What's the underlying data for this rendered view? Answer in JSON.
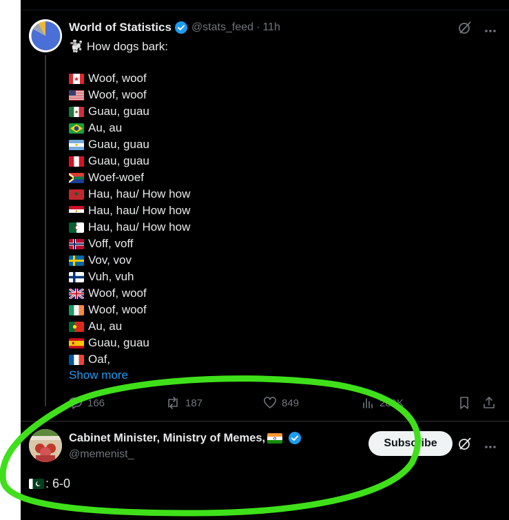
{
  "post": {
    "author_name": "World of Statistics",
    "handle": "@stats_feed",
    "separator": "·",
    "time": "11h",
    "intro": "How dogs bark:",
    "intro_emoji": "🐩",
    "lines": [
      {
        "flag": "canada",
        "text": "Woof, woof"
      },
      {
        "flag": "usa",
        "text": "Woof, woof"
      },
      {
        "flag": "mexico",
        "text": "Guau, guau"
      },
      {
        "flag": "brazil",
        "text": "Au, au"
      },
      {
        "flag": "argentina",
        "text": "Guau, guau"
      },
      {
        "flag": "peru",
        "text": "Guau, guau"
      },
      {
        "flag": "south-africa",
        "text": "Woef-woef"
      },
      {
        "flag": "morocco",
        "text": "Hau, hau/ How how"
      },
      {
        "flag": "egypt",
        "text": "Hau, hau/ How how"
      },
      {
        "flag": "algeria",
        "text": "Hau, hau/ How how"
      },
      {
        "flag": "norway",
        "text": "Voff, voff"
      },
      {
        "flag": "sweden",
        "text": "Vov, vov"
      },
      {
        "flag": "finland",
        "text": "Vuh, vuh"
      },
      {
        "flag": "uk",
        "text": "Woof, woof"
      },
      {
        "flag": "ireland",
        "text": "Woof, woof"
      },
      {
        "flag": "portugal",
        "text": "Au, au"
      },
      {
        "flag": "spain",
        "text": "Guau, guau"
      },
      {
        "flag": "france",
        "text": "Oaf,"
      }
    ],
    "show_more": "Show more",
    "stats": {
      "replies": "166",
      "reposts": "187",
      "likes": "849",
      "views": "289K"
    }
  },
  "reply": {
    "author_name": "Cabinet Minister, Ministry of Memes,",
    "name_flag": "india",
    "handle": "@memenist_",
    "subscribe_label": "Subscribe",
    "text_flag": "pakistan",
    "text": ": 6-0"
  },
  "colors": {
    "background": "#000000",
    "text": "#e7e9ea",
    "muted": "#71767b",
    "link": "#1d9bf0",
    "verified": "#1d9bf0",
    "highlight": "#3fe01a"
  },
  "icons": [
    "verified-badge-icon",
    "grok-icon",
    "more-icon",
    "reply-icon",
    "repost-icon",
    "like-icon",
    "views-icon",
    "bookmark-icon",
    "share-icon"
  ]
}
